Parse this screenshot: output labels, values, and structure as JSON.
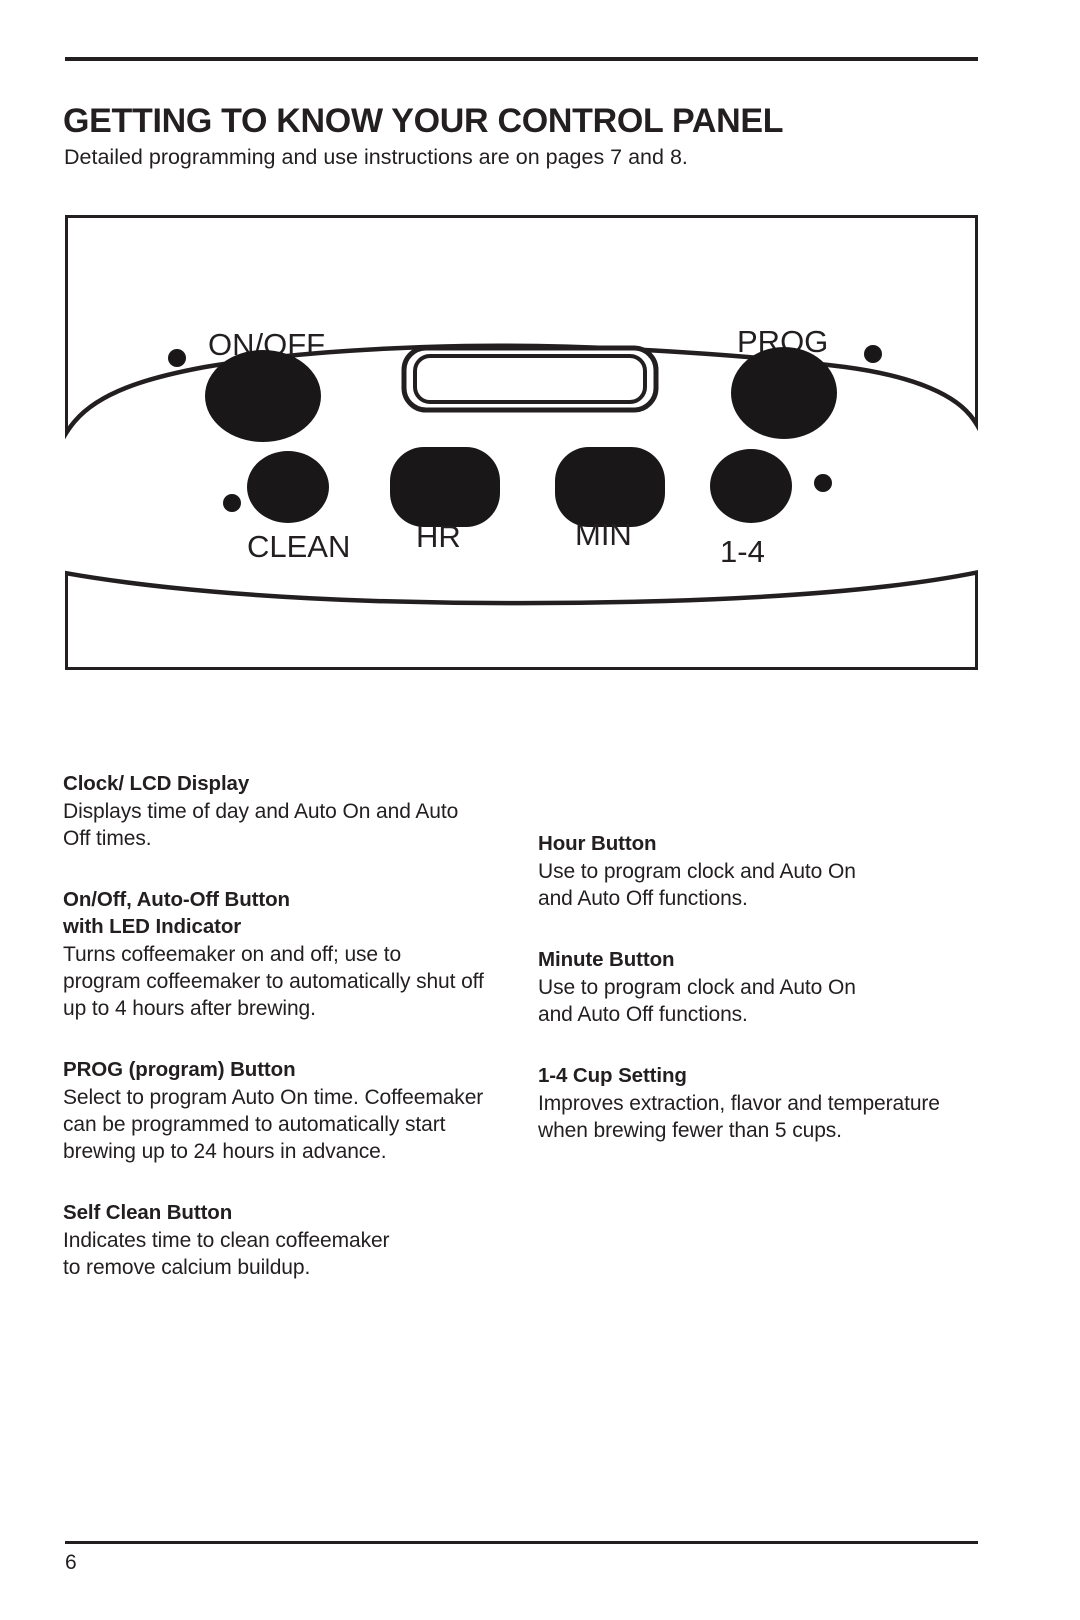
{
  "document": {
    "title": "GETTING TO KNOW YOUR CONTROL PANEL",
    "subtitle": "Detailed programming and use instructions are on pages 7 and 8.",
    "page_number": "6"
  },
  "figure": {
    "name": "control-panel-diagram",
    "labels": {
      "on_off": "ON/OFF",
      "prog": "PROG",
      "clean": "CLEAN",
      "hr": "HR",
      "min": "MIN",
      "cup_setting": "1-4"
    },
    "colors": {
      "button_fill": "#1a1718",
      "outline": "#231f20",
      "panel_fill": "#ffffff"
    }
  },
  "left_column": [
    {
      "title": "Clock/ LCD Display",
      "body": "Displays time of day and Auto On and Auto\nOff times."
    },
    {
      "title": "On/Off, Auto-Off Button\nwith LED Indicator",
      "body": "Turns coffeemaker on and off; use to\nprogram coffeemaker to automatically shut off\nup to 4 hours after brewing."
    },
    {
      "title": "PROG (program) Button",
      "body": "Select to program Auto On time. Coffeemaker\ncan be programmed to automatically start\nbrewing up to 24 hours in advance."
    },
    {
      "title": "Self Clean Button",
      "body": "Indicates time to clean coffeemaker\nto remove calcium buildup."
    }
  ],
  "right_column": [
    {
      "title": "Hour Button",
      "body": "Use to program clock and Auto On\nand Auto Off functions."
    },
    {
      "title": "Minute Button",
      "body": "Use to program clock and Auto On\n and Auto Off functions."
    },
    {
      "title": "1-4 Cup Setting",
      "body": "Improves extraction, flavor and temperature\nwhen brewing fewer than 5 cups."
    }
  ]
}
